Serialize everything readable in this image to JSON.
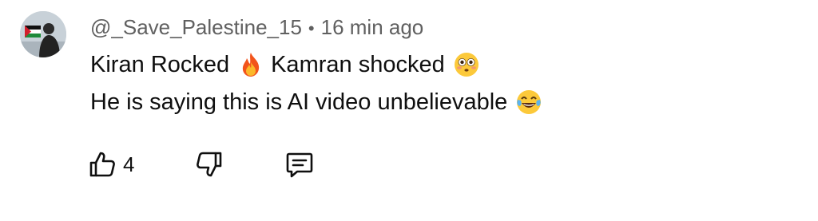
{
  "comment": {
    "author": "@_Save_Palestine_15",
    "separator": "•",
    "time": "16 min ago",
    "line1_part1": "Kiran Rocked",
    "line1_part2": "Kamran shocked",
    "line2": "He is saying this is AI video unbelievable",
    "emojis": [
      "fire-emoji",
      "flushed-face-emoji",
      "tears-of-joy-emoji"
    ]
  },
  "actions": {
    "like_count": "4",
    "icons": [
      "thumbs-up-icon",
      "thumbs-down-icon",
      "reply-icon"
    ]
  },
  "colors": {
    "text_primary": "#0f0f0f",
    "text_secondary": "#606060",
    "background": "#ffffff"
  }
}
